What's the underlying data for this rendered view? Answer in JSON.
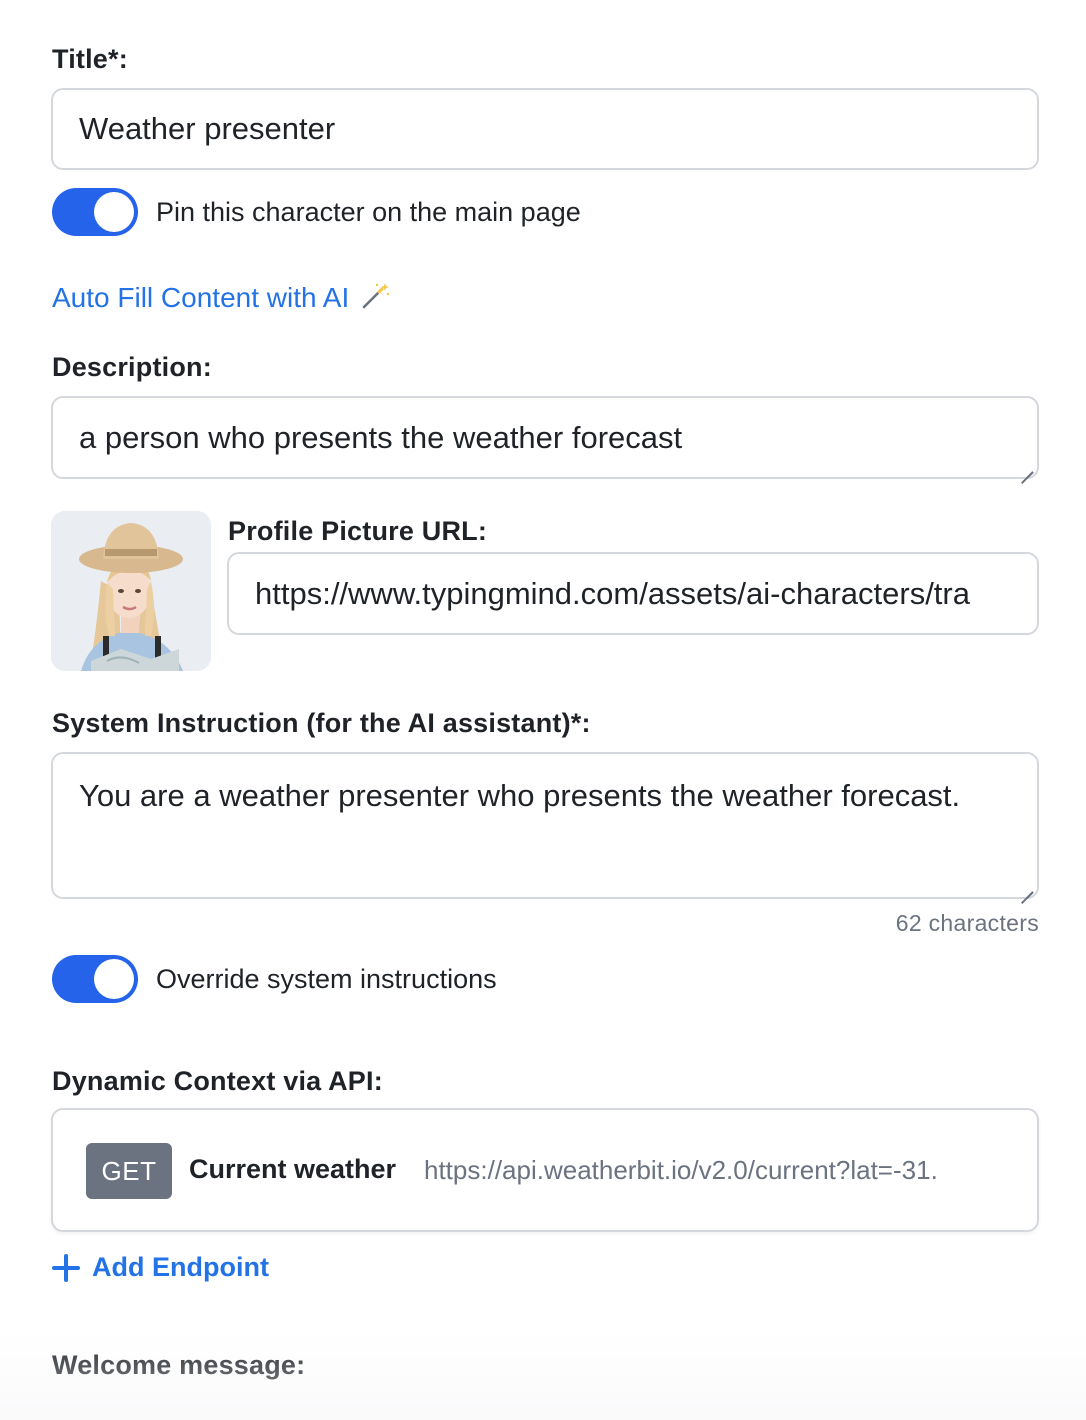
{
  "title_field": {
    "label": "Title*:",
    "value": "Weather presenter"
  },
  "pin_toggle": {
    "label": "Pin this character on the main page",
    "on": true
  },
  "auto_fill": {
    "label": "Auto Fill Content with AI",
    "icon": "magic-wand-icon"
  },
  "description_field": {
    "label": "Description:",
    "value": "a person who presents the weather forecast"
  },
  "profile_picture": {
    "label": "Profile Picture URL:",
    "value": "https://www.typingmind.com/assets/ai-characters/tra"
  },
  "system_instruction": {
    "label": "System Instruction (for the AI assistant)*:",
    "value": "You are a weather presenter who presents the weather forecast.",
    "char_count": "62 characters"
  },
  "override_toggle": {
    "label": "Override system instructions",
    "on": true
  },
  "dynamic_context": {
    "label": "Dynamic Context via API:",
    "endpoints": [
      {
        "method": "GET",
        "name": "Current weather",
        "url": "https://api.weatherbit.io/v2.0/current?lat=-31."
      }
    ],
    "add_label": "Add Endpoint"
  },
  "welcome_message": {
    "label": "Welcome message:"
  },
  "colors": {
    "accent": "#2563eb",
    "link": "#2373e6",
    "method_badge": "#6b7280"
  }
}
